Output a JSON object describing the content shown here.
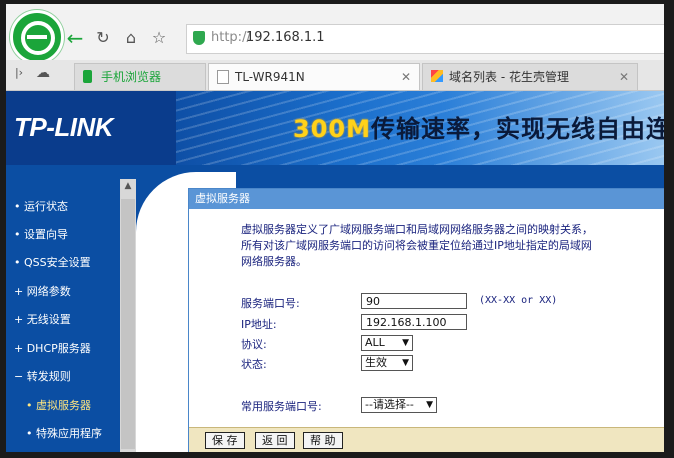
{
  "browser": {
    "url_protocol": "http://",
    "url_host": "192.168.1.1",
    "tabs": [
      {
        "label": "手机浏览器",
        "active": false
      },
      {
        "label": "TL-WR941N",
        "active": true,
        "close": "✕"
      },
      {
        "label": "域名列表 - 花生壳管理",
        "active": false,
        "close": "✕"
      }
    ]
  },
  "banner": {
    "logo": "TP-LINK",
    "slogan_highlight": "300M",
    "slogan_text": "传输速率，实现无线自由连"
  },
  "sidebar": {
    "items": [
      {
        "label": "• 运行状态"
      },
      {
        "label": "• 设置向导"
      },
      {
        "label": "• QSS安全设置"
      },
      {
        "label": "+ 网络参数"
      },
      {
        "label": "+ 无线设置"
      },
      {
        "label": "+ DHCP服务器"
      },
      {
        "label": "− 转发规则"
      },
      {
        "label": "• 虚拟服务器"
      },
      {
        "label": "• 特殊应用程序"
      }
    ]
  },
  "panel": {
    "title": "虚拟服务器",
    "description_lines": [
      "虚拟服务器定义了广域网服务端口和局域网网络服务器之间的映射关系，",
      "所有对该广域网服务端口的访问将会被重定位给通过IP地址指定的局域网",
      "网络服务器。"
    ],
    "port_label": "服务端口号:",
    "port_value": "90",
    "port_hint": "(XX-XX or XX)",
    "ip_label": "IP地址:",
    "ip_value": "192.168.1.100",
    "protocol_label": "协议:",
    "protocol_value": "ALL",
    "status_label": "状态:",
    "status_value": "生效",
    "common_label": "常用服务端口号:",
    "common_value": "--请选择--",
    "buttons": {
      "save": "保 存",
      "back": "返 回",
      "help": "帮 助"
    }
  },
  "colors": {
    "tplink_blue": "#0b4ea3",
    "panel_header": "#5a95d6",
    "button_bar": "#f0e6c0",
    "slogan_highlight": "#ffd21a"
  }
}
